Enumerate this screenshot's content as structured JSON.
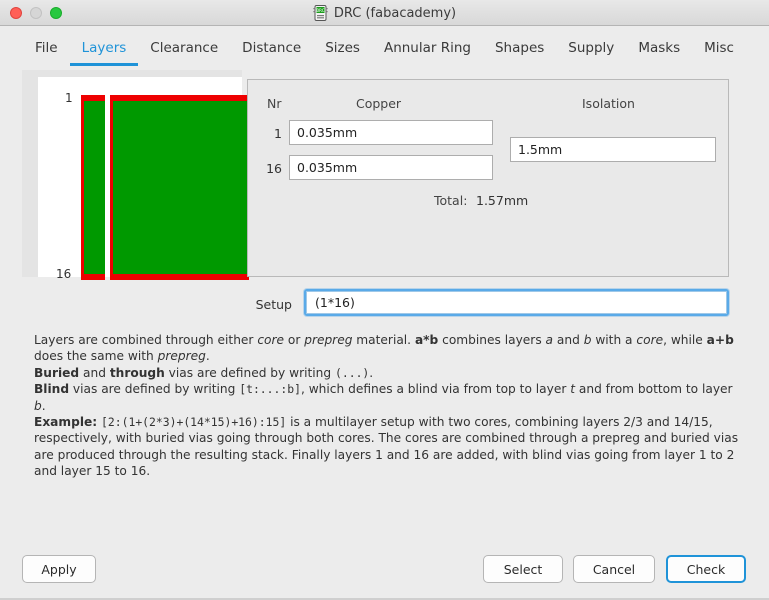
{
  "window": {
    "title": "DRC (fabacademy)",
    "icon": "pcb-chip-icon",
    "controls": {
      "close": "close-button",
      "minimize": "minimize-button",
      "zoom": "zoom-button"
    }
  },
  "tabs": {
    "active": "Layers",
    "items": [
      {
        "label": "File"
      },
      {
        "label": "Layers"
      },
      {
        "label": "Clearance"
      },
      {
        "label": "Distance"
      },
      {
        "label": "Sizes"
      },
      {
        "label": "Annular Ring"
      },
      {
        "label": "Shapes"
      },
      {
        "label": "Supply"
      },
      {
        "label": "Masks"
      },
      {
        "label": "Misc"
      }
    ]
  },
  "diagram": {
    "top_layer_label": "1",
    "bottom_layer_label": "16",
    "copper_color": "#ee0000",
    "isolation_color": "#009900",
    "background_color": "#ffffff"
  },
  "stackup": {
    "headers": {
      "nr": "Nr",
      "copper": "Copper",
      "isolation": "Isolation"
    },
    "rows": [
      {
        "nr": "1",
        "copper": "0.035mm"
      },
      {
        "nr": "16",
        "copper": "0.035mm"
      }
    ],
    "isolation": [
      {
        "value": "1.5mm"
      }
    ],
    "total_label": "Total:",
    "total_value": "1.57mm"
  },
  "setup": {
    "label": "Setup",
    "value": "(1*16)",
    "focused": true,
    "focus_color": "#5aaae8"
  },
  "description": {
    "paragraphs": [
      "Layers are combined through either core or prepreg material. a*b combines layers a and b with a core, while a+b does the same with prepreg.",
      "Buried and through vias are defined by writing (...).",
      "Blind vias are defined by writing [t:...:b], which defines a blind via from top to layer t and from bottom to layer b.",
      "Example: [2:(1+(2*3)+(14*15)+16):15] is a multilayer setup with two cores, combining layers 2/3 and 14/15, respectively, with buried vias going through both cores. The cores are combined through a prepreg and buried vias are produced through the resulting stack. Finally layers 1 and 16 are added, with blind vias going from layer 1 to 2 and layer 15 to 16."
    ],
    "terms": {
      "core": "core",
      "prepreg": "prepreg",
      "a_times_b": "a*b",
      "a_plus_b": "a+b",
      "buried": "Buried",
      "through": "through",
      "blind": "Blind",
      "example": "Example:",
      "buried_syntax": "(...)",
      "blind_syntax": "[t:...:b]",
      "example_syntax": "[2:(1+(2*3)+(14*15)+16):15]"
    }
  },
  "footer": {
    "apply": "Apply",
    "select": "Select",
    "cancel": "Cancel",
    "check": "Check",
    "default_button": "Check",
    "accent_color": "#1f93d8"
  }
}
